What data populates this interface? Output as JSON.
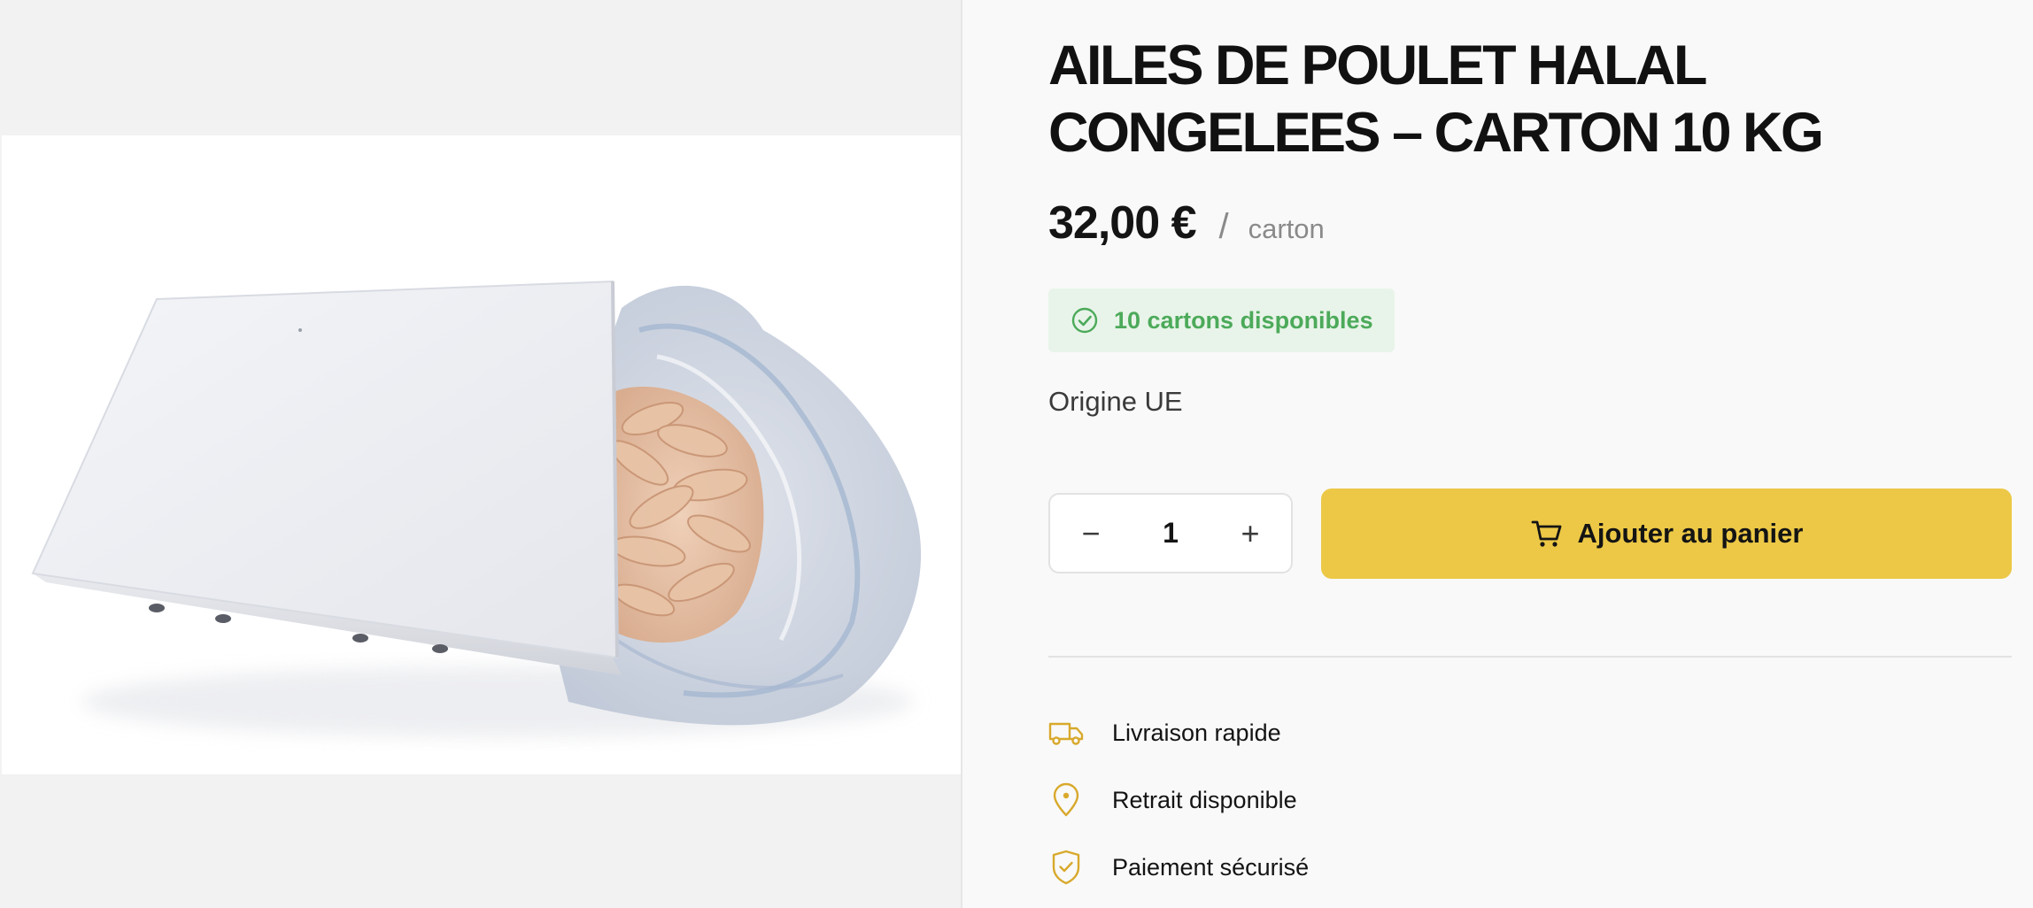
{
  "product": {
    "title": "AILES DE POULET HALAL CONGELEES – CARTON 10 KG",
    "price": "32,00 €",
    "price_separator": "/",
    "price_unit": "carton",
    "stock_text": "10 cartons disponibles",
    "origin": "Origine UE"
  },
  "cart": {
    "quantity": "1",
    "decrement_symbol": "−",
    "increment_symbol": "+",
    "add_label": "Ajouter au panier"
  },
  "features": [
    {
      "icon": "truck-icon",
      "label": "Livraison rapide"
    },
    {
      "icon": "location-pin-icon",
      "label": "Retrait disponible"
    },
    {
      "icon": "shield-check-icon",
      "label": "Paiement sécurisé"
    }
  ],
  "colors": {
    "accent": "#ecc846",
    "icon_accent": "#d8a92c",
    "stock_green": "#4caa5a",
    "stock_bg": "#e8f4e9",
    "page_bg": "#f9f9f9",
    "gallery_bg": "#f2f2f2"
  }
}
